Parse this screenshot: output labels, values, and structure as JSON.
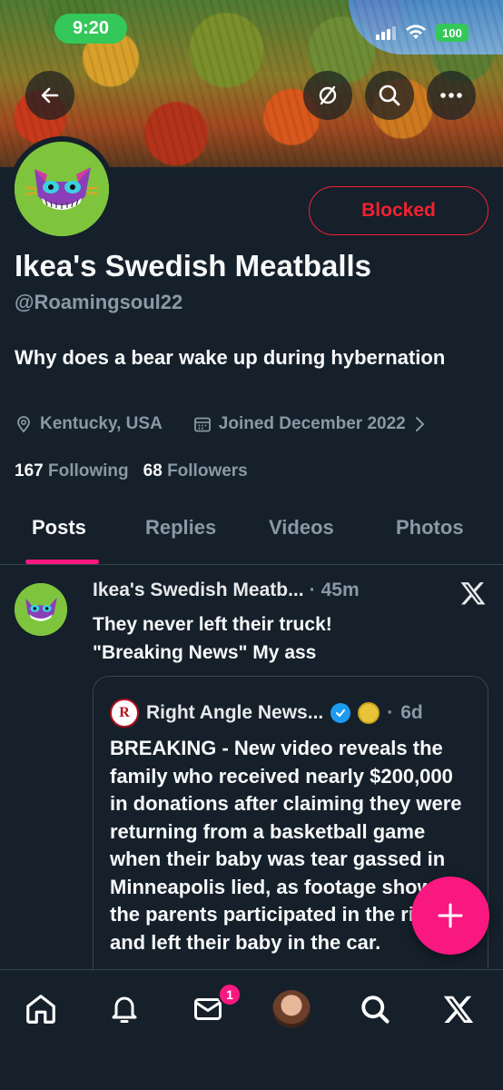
{
  "status_bar": {
    "time": "9:20",
    "battery": "100"
  },
  "profile": {
    "display_name": "Ikea's Swedish Meatballs",
    "handle": "@Roamingsoul22",
    "bio": "Why does a bear wake up during hybernation",
    "location": "Kentucky, USA",
    "joined": "Joined December 2022",
    "following_count": "167",
    "following_label": "Following",
    "followers_count": "68",
    "followers_label": "Followers",
    "blocked_label": "Blocked"
  },
  "tabs": [
    "Posts",
    "Replies",
    "Videos",
    "Photos"
  ],
  "post": {
    "author": "Ikea's Swedish Meatb...",
    "time": "45m",
    "dot": "·",
    "text_line1": "They never left their truck!",
    "text_line2": "\"Breaking News\" My ass",
    "quote": {
      "logo_letter": "R",
      "author": "Right Angle News...",
      "time": "6d",
      "text": "BREAKING - New video reveals the family who received nearly $200,000 in donations after claiming they were returning from a basketball game when their baby was tear gassed in Minneapolis lied, as footage shows the parents participated in the riots and left their baby in the car."
    }
  },
  "nav": {
    "notifications_badge": "1"
  },
  "icons": [
    "back-arrow-icon",
    "hide-icon",
    "search-icon",
    "more-icon",
    "location-icon",
    "calendar-icon",
    "chevron-right-icon",
    "x-logo-icon",
    "verified-badge-icon",
    "plus-icon",
    "home-icon",
    "bell-icon",
    "mail-icon",
    "search-nav-icon",
    "x-nav-icon"
  ],
  "colors": {
    "accent_pink": "#f91880",
    "blocked_red": "#f4212e",
    "verified_blue": "#1d9bf0",
    "background": "#15202b"
  }
}
